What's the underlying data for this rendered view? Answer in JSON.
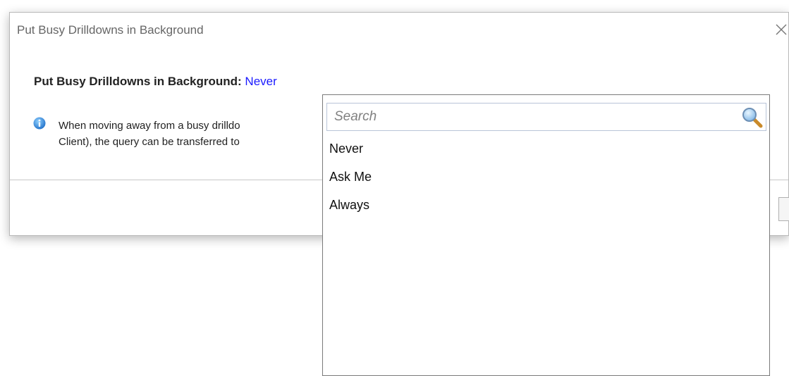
{
  "dialog": {
    "title": "Put Busy Drilldowns in Background",
    "setting_label": "Put Busy Drilldowns in Background:",
    "setting_value": "Never",
    "description_line1": "When moving away from a busy drilldo",
    "description_line2": "Client), the query can be transferred to"
  },
  "dropdown": {
    "search_placeholder": "Search",
    "options": [
      {
        "label": "Never"
      },
      {
        "label": "Ask Me"
      },
      {
        "label": "Always"
      }
    ]
  },
  "icons": {
    "close": "close-icon",
    "info": "info-icon",
    "search": "search-icon"
  },
  "colors": {
    "value_link": "#1a1aff",
    "title_text": "#666666",
    "info_blue": "#2f7fd6",
    "dropdown_border": "#7a7a7a"
  }
}
